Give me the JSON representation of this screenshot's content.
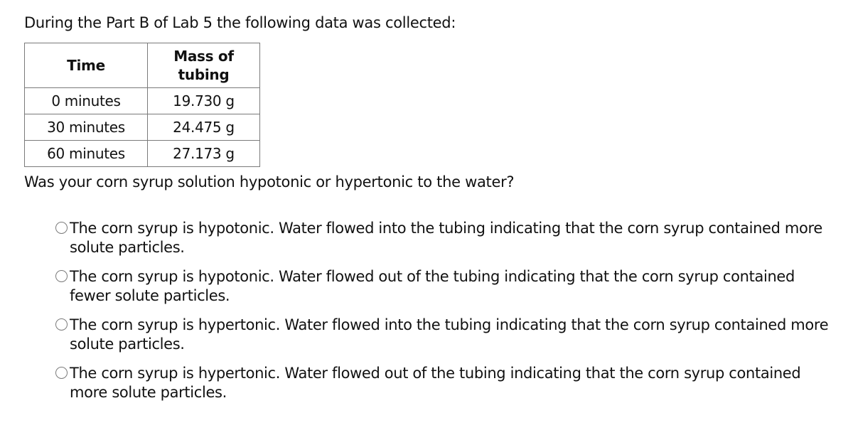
{
  "intro_text": "During the Part B of Lab 5 the following data was collected:",
  "table": {
    "headers": [
      "Time",
      "Mass of tubing"
    ],
    "rows": [
      {
        "time": "0 minutes",
        "mass": "19.730 g"
      },
      {
        "time": "30 minutes",
        "mass": "24.475 g"
      },
      {
        "time": "60 minutes",
        "mass": "27.173 g"
      }
    ]
  },
  "question": "Was your corn syrup solution hypotonic or hypertonic to the water?",
  "options": [
    {
      "icon": "radio-unselected-icon",
      "selected": false,
      "text": "The corn syrup is hypotonic. Water flowed into the tubing indicating that the corn syrup contained more solute particles."
    },
    {
      "icon": "radio-unselected-icon",
      "selected": false,
      "text": "The corn syrup is hypotonic. Water flowed out of the tubing indicating that the corn syrup contained fewer solute particles."
    },
    {
      "icon": "radio-unselected-icon",
      "selected": false,
      "text": "The corn syrup is hypertonic. Water flowed into the tubing indicating that the corn syrup contained more solute particles."
    },
    {
      "icon": "radio-unselected-icon",
      "selected": false,
      "text": "The corn syrup is hypertonic. Water flowed out of the tubing indicating that the corn syrup contained more solute particles."
    }
  ]
}
